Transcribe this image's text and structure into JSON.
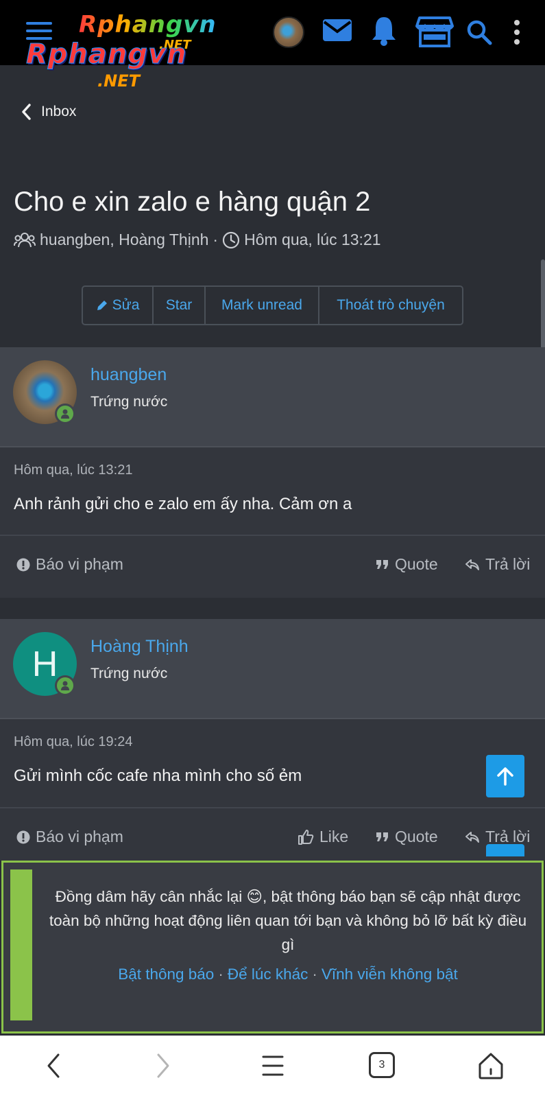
{
  "header": {
    "logo_main": "Rphangvn",
    "logo_net": ".NET",
    "logo_secondary": "Rphangvn",
    "logo_secondary_net": ".NET",
    "icons": [
      "menu-icon",
      "avatar",
      "mail-icon",
      "bell-icon",
      "store-icon",
      "search-icon",
      "more-vertical-icon"
    ],
    "accent_color": "#2f7fe0"
  },
  "nav": {
    "back_label": "Inbox"
  },
  "conversation": {
    "title": "Cho e xin zalo e hàng quận 2",
    "participants": "huangben, Hoàng Thịnh",
    "separator": "·",
    "time": "Hôm qua, lúc 13:21"
  },
  "actions": {
    "edit": "Sửa",
    "star": "Star",
    "mark_unread": "Mark unread",
    "leave": "Thoát trò chuyện"
  },
  "messages": [
    {
      "author": "huangben",
      "role": "Trứng nước",
      "date": "Hôm qua, lúc 13:21",
      "body": "Anh rảnh gửi cho e zalo em ấy nha. Cảm ơn a",
      "report": "Báo vi phạm",
      "quote": "Quote",
      "reply": "Trả lời"
    },
    {
      "author": "Hoàng Thịnh",
      "avatar_letter": "H",
      "role": "Trứng nước",
      "date": "Hôm qua, lúc 19:24",
      "body": "Gửi mình cốc cafe nha mình cho số ẻm",
      "report": "Báo vi phạm",
      "like": "Like",
      "quote": "Quote",
      "reply": "Trả lời"
    }
  ],
  "notification": {
    "text": "Đồng dâm hãy cân nhắc lại 😊, bật thông báo bạn sẽ cập nhật được toàn bộ những hoạt động liên quan tới bạn và không bỏ lỡ bất kỳ điều gì",
    "enable": "Bật thông báo",
    "later": "Để lúc khác",
    "never": "Vĩnh viễn không bật",
    "dot": "·",
    "accent": "#8bc34a"
  },
  "browser_nav": {
    "tab_count": "3"
  }
}
